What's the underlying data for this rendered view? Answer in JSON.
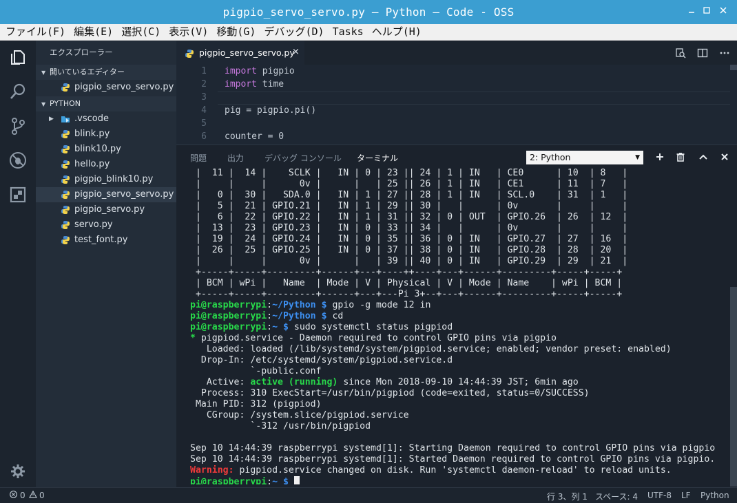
{
  "window": {
    "title": "pigpio_servo_servo.py — Python — Code - OSS"
  },
  "menu": [
    "ファイル(F)",
    "編集(E)",
    "選択(C)",
    "表示(V)",
    "移動(G)",
    "デバッグ(D)",
    "Tasks",
    "ヘルプ(H)"
  ],
  "sidebar": {
    "title": "エクスプローラー",
    "open_editors_label": "開いているエディター",
    "open_editors": [
      "pigpio_servo_servo.py"
    ],
    "folder_label": "PYTHON",
    "files": [
      ".vscode",
      "blink.py",
      "blink10.py",
      "hello.py",
      "pigpio_blink10.py",
      "pigpio_servo_servo.py",
      "pigpio_servo.py",
      "servo.py",
      "test_font.py"
    ]
  },
  "editor": {
    "tab_label": "pigpio_servo_servo.py",
    "close_glyph": "×",
    "lines": [
      {
        "n": "1",
        "kw": "import",
        "rest": " pigpio"
      },
      {
        "n": "2",
        "kw": "import",
        "rest": " time"
      },
      {
        "n": "3",
        "kw": "",
        "rest": ""
      },
      {
        "n": "4",
        "kw": "",
        "rest": "pig = pigpio.pi()"
      },
      {
        "n": "5",
        "kw": "",
        "rest": ""
      },
      {
        "n": "6",
        "kw": "",
        "rest": "counter = 0"
      }
    ]
  },
  "panel": {
    "tabs": [
      "問題",
      "出力",
      "デバッグ コンソール",
      "ターミナル"
    ],
    "active_tab": "ターミナル",
    "terminal_select": "2: Python",
    "icons": [
      "plus-icon",
      "trash-icon",
      "chevron-up-icon",
      "close-icon"
    ]
  },
  "terminal": {
    "table_rows": [
      " |  11 |  14 |    SCLK |   IN | 0 | 23 || 24 | 1 | IN   | CE0      | 10  | 8   |",
      " |     |     |      0v |      |   | 25 || 26 | 1 | IN   | CE1      | 11  | 7   |",
      " |   0 |  30 |   SDA.0 |   IN | 1 | 27 || 28 | 1 | IN   | SCL.0    | 31  | 1   |",
      " |   5 |  21 | GPIO.21 |   IN | 1 | 29 || 30 |   |      | 0v       |     |     |",
      " |   6 |  22 | GPIO.22 |   IN | 1 | 31 || 32 | 0 | OUT  | GPIO.26  | 26  | 12  |",
      " |  13 |  23 | GPIO.23 |   IN | 0 | 33 || 34 |   |      | 0v       |     |     |",
      " |  19 |  24 | GPIO.24 |   IN | 0 | 35 || 36 | 0 | IN   | GPIO.27  | 27  | 16  |",
      " |  26 |  25 | GPIO.25 |   IN | 0 | 37 || 38 | 0 | IN   | GPIO.28  | 28  | 20  |",
      " |     |     |      0v |      |   | 39 || 40 | 0 | IN   | GPIO.29  | 29  | 21  |",
      " +-----+-----+---------+------+---+----++----+---+------+---------+-----+-----+",
      " | BCM | wPi |   Name  | Mode | V | Physical | V | Mode | Name    | wPi | BCM |",
      " +-----+-----+---------+------+---+---Pi 3+--+---+------+---------+-----+-----+"
    ],
    "prompt_user": "pi@raspberrypi",
    "prompt_path_python": "~/Python",
    "prompt_path_home": "~",
    "cmd1": " gpio -g mode 12 in",
    "cmd2": " cd",
    "cmd3": " sudo systemctl status pigpiod",
    "status_bullet": "*",
    "status_title": " pigpiod.service - Daemon required to control GPIO pins via pigpio",
    "loaded": "   Loaded: loaded (/lib/systemd/system/pigpiod.service; enabled; vendor preset: enabled)",
    "dropin1": "  Drop-In: /etc/systemd/system/pigpiod.service.d",
    "dropin2": "           `-public.conf",
    "active_label": "   Active: ",
    "active_value": "active (running)",
    "active_rest": " since Mon 2018-09-10 14:44:39 JST; 6min ago",
    "process": "  Process: 310 ExecStart=/usr/bin/pigpiod (code=exited, status=0/SUCCESS)",
    "mainpid": " Main PID: 312 (pigpiod)",
    "cgroup1": "   CGroup: /system.slice/pigpiod.service",
    "cgroup2": "           `-312 /usr/bin/pigpiod",
    "log1": "Sep 10 14:44:39 raspberrypi systemd[1]: Starting Daemon required to control GPIO pins via pigpio",
    "log2": "Sep 10 14:44:39 raspberrypi systemd[1]: Started Daemon required to control GPIO pins via pigpio.",
    "warning_label": "Warning:",
    "warning_text": " pigpiod.service changed on disk. Run 'systemctl daemon-reload' to reload units."
  },
  "status": {
    "errors": "0",
    "warnings": "0",
    "position": "行 3、列 1",
    "spaces": "スペース: 4",
    "encoding": "UTF-8",
    "eol": "LF",
    "language": "Python"
  },
  "colors": {
    "titlebar": "#3b9ed1",
    "prompt_green": "#28d94a",
    "prompt_blue": "#3d8ff0",
    "warning_red": "#ef3a3a",
    "keyword": "#c678dd"
  }
}
